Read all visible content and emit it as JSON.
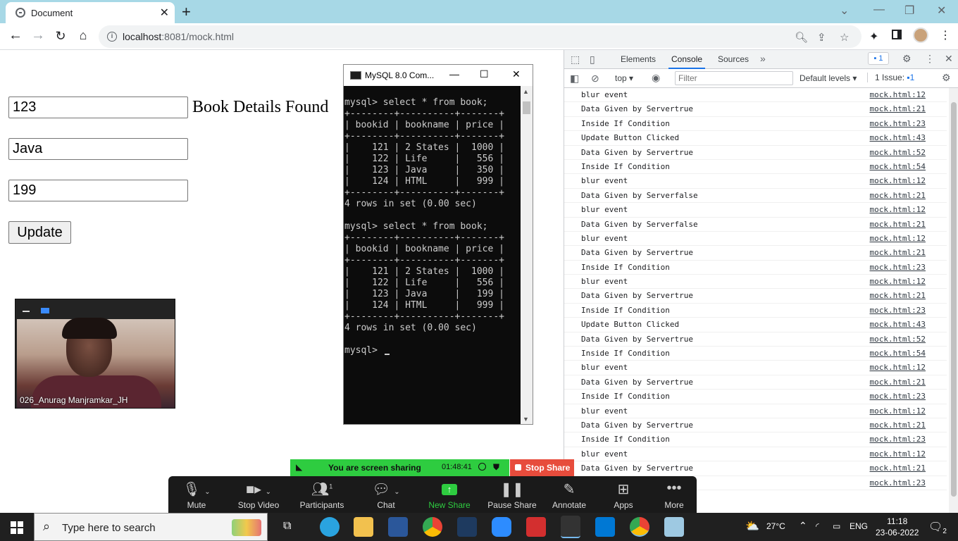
{
  "browser": {
    "tab_title": "Document",
    "url_host": "localhost",
    "url_rest": ":8081/mock.html"
  },
  "page": {
    "input_id": "123",
    "input_name": "Java",
    "input_price": "199",
    "status_text": "Book Details Found",
    "update_label": "Update"
  },
  "video": {
    "participant": "026_Anurag Manjramkar_JH"
  },
  "mysql": {
    "title": "MySQL 8.0 Com...",
    "output": "mysql> select * from book;\n+--------+----------+-------+\n| bookid | bookname | price |\n+--------+----------+-------+\n|    121 | 2 States |  1000 |\n|    122 | Life     |   556 |\n|    123 | Java     |   350 |\n|    124 | HTML     |   999 |\n+--------+----------+-------+\n4 rows in set (0.00 sec)\n\nmysql> select * from book;\n+--------+----------+-------+\n| bookid | bookname | price |\n+--------+----------+-------+\n|    121 | 2 States |  1000 |\n|    122 | Life     |   556 |\n|    123 | Java     |   199 |\n|    124 | HTML     |   999 |\n+--------+----------+-------+\n4 rows in set (0.00 sec)\n\nmysql> "
  },
  "devtools": {
    "tabs": [
      "Elements",
      "Console",
      "Sources"
    ],
    "issue_count": "1",
    "context": "top",
    "filter_placeholder": "Filter",
    "levels": "Default levels",
    "issue_label": "1 Issue:",
    "issue_badge_count": "1",
    "logs": [
      {
        "msg": "blur event",
        "src": "mock.html:12"
      },
      {
        "msg": "Data Given by Servertrue",
        "src": "mock.html:21"
      },
      {
        "msg": "Inside If Condition",
        "src": "mock.html:23"
      },
      {
        "msg": "Update Button Clicked",
        "src": "mock.html:43"
      },
      {
        "msg": "Data Given by Servertrue",
        "src": "mock.html:52"
      },
      {
        "msg": "Inside If Condition",
        "src": "mock.html:54"
      },
      {
        "msg": "blur event",
        "src": "mock.html:12"
      },
      {
        "msg": "Data Given by Serverfalse",
        "src": "mock.html:21"
      },
      {
        "msg": "blur event",
        "src": "mock.html:12"
      },
      {
        "msg": "Data Given by Serverfalse",
        "src": "mock.html:21"
      },
      {
        "msg": "blur event",
        "src": "mock.html:12"
      },
      {
        "msg": "Data Given by Servertrue",
        "src": "mock.html:21"
      },
      {
        "msg": "Inside If Condition",
        "src": "mock.html:23"
      },
      {
        "msg": "blur event",
        "src": "mock.html:12"
      },
      {
        "msg": "Data Given by Servertrue",
        "src": "mock.html:21"
      },
      {
        "msg": "Inside If Condition",
        "src": "mock.html:23"
      },
      {
        "msg": "Update Button Clicked",
        "src": "mock.html:43"
      },
      {
        "msg": "Data Given by Servertrue",
        "src": "mock.html:52"
      },
      {
        "msg": "Inside If Condition",
        "src": "mock.html:54"
      },
      {
        "msg": "blur event",
        "src": "mock.html:12"
      },
      {
        "msg": "Data Given by Servertrue",
        "src": "mock.html:21"
      },
      {
        "msg": "Inside If Condition",
        "src": "mock.html:23"
      },
      {
        "msg": "blur event",
        "src": "mock.html:12"
      },
      {
        "msg": "Data Given by Servertrue",
        "src": "mock.html:21"
      },
      {
        "msg": "Inside If Condition",
        "src": "mock.html:23"
      },
      {
        "msg": "blur event",
        "src": "mock.html:12"
      },
      {
        "msg": "Data Given by Servertrue",
        "src": "mock.html:21"
      },
      {
        "msg": "",
        "src": "mock.html:23"
      }
    ]
  },
  "zoom": {
    "sharing_text": "You are screen sharing",
    "timer": "01:48:41",
    "stop_share": "Stop Share",
    "participants_count": "1",
    "buttons": [
      "Mute",
      "Stop Video",
      "Participants",
      "Chat",
      "New Share",
      "Pause Share",
      "Annotate",
      "Apps",
      "More"
    ]
  },
  "taskbar": {
    "search_placeholder": "Type here to search",
    "weather": "27°C",
    "language": "ENG",
    "time": "11:18",
    "date": "23-06-2022",
    "notifications": "2"
  },
  "colors": {
    "tabstrip": "#a7d8e6",
    "zoom_green": "#2ecc40",
    "zoom_red": "#e74c3c",
    "console_bg": "#0c0c0c"
  }
}
